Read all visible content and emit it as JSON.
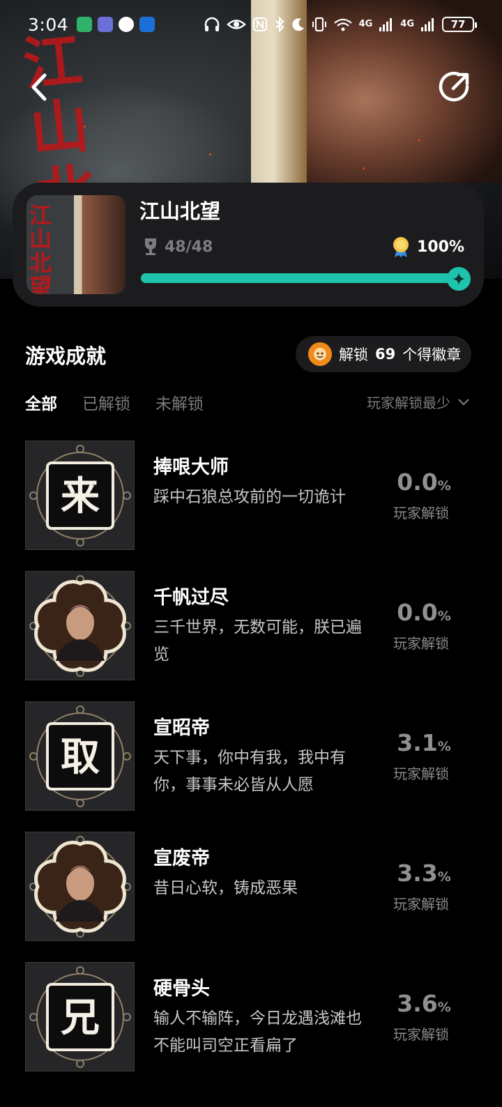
{
  "status_bar": {
    "time": "3:04",
    "network_1": "4G",
    "network_2": "4G",
    "battery": "77"
  },
  "hero": {
    "calligraphy": [
      "江",
      "山",
      "北",
      "望"
    ]
  },
  "nav": {
    "back_icon": "chevron-left-icon",
    "share_icon": "share-icon"
  },
  "game": {
    "title": "江山北望",
    "achievements_count": "48/48",
    "completion": "100%",
    "progress": 1.0,
    "accent_color": "#1fc3ac"
  },
  "section": {
    "title": "游戏成就",
    "badge_prefix": "解锁",
    "badge_count": "69",
    "badge_suffix": "个得徽章"
  },
  "tabs": [
    {
      "label": "全部",
      "active": true
    },
    {
      "label": "已解锁",
      "active": false
    },
    {
      "label": "未解锁",
      "active": false
    }
  ],
  "sort": {
    "label": "玩家解锁最少"
  },
  "achievements": [
    {
      "name": "捧哏大师",
      "desc": "踩中石狼总攻前的一切诡计",
      "pct": "0.0",
      "label": "玩家解锁",
      "glyph": "来",
      "kind": "seal"
    },
    {
      "name": "千帆过尽",
      "desc": "三千世界，无数可能，朕已遍览",
      "pct": "0.0",
      "label": "玩家解锁",
      "glyph": "",
      "kind": "portrait"
    },
    {
      "name": "宣昭帝",
      "desc": "天下事，你中有我，我中有你，事事未必皆从人愿",
      "pct": "3.1",
      "label": "玩家解锁",
      "glyph": "取",
      "kind": "seal"
    },
    {
      "name": "宣废帝",
      "desc": "昔日心软，铸成恶果",
      "pct": "3.3",
      "label": "玩家解锁",
      "glyph": "",
      "kind": "portrait"
    },
    {
      "name": "硬骨头",
      "desc": "输人不输阵，今日龙遇浅滩也不能叫司空正看扁了",
      "pct": "3.6",
      "label": "玩家解锁",
      "glyph": "兄",
      "kind": "seal"
    }
  ],
  "percent_sign": "%"
}
